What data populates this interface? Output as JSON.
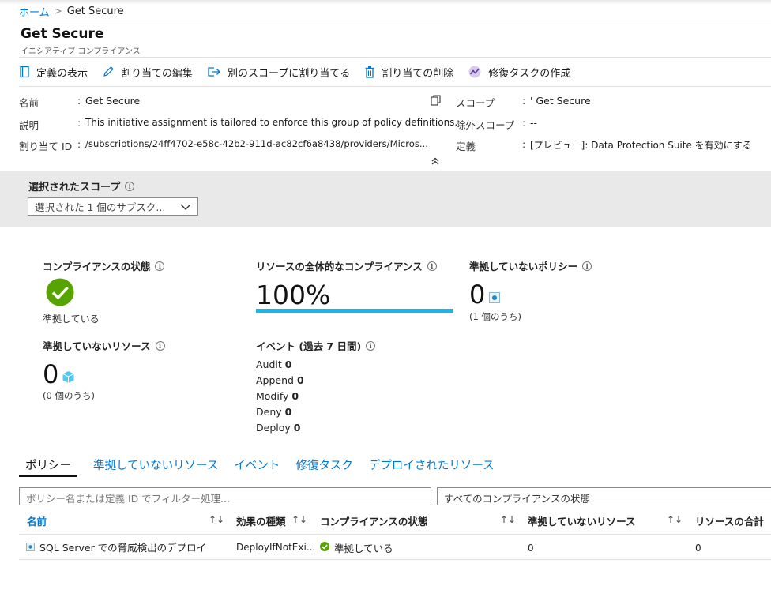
{
  "breadcrumb": {
    "home": "ホーム",
    "current": "Get Secure"
  },
  "header": {
    "title": "Get Secure",
    "subtitle": "イニシアティブ コンプライアンス"
  },
  "toolbar": {
    "view_definition": "定義の表示",
    "edit_assignment": "割り当ての編集",
    "assign_other_scope": "別のスコープに割り当てる",
    "delete_assignment": "割り当ての削除",
    "create_remediation": "修復タスクの作成"
  },
  "essentials": {
    "name_label": "名前",
    "name_value": "Get Secure",
    "desc_label": "説明",
    "desc_value": "This initiative assignment is tailored to enforce this group of policy definitions.",
    "id_label": "割り当て ID",
    "id_value": "/subscriptions/24ff4702-e58c-42b2-911d-ac82cf6a8438/providers/Micros...",
    "scope_label": "スコープ",
    "scope_value": "' Get Secure",
    "excluded_label": "除外スコープ",
    "excluded_value": "--",
    "definition_label": "定義",
    "definition_value": "[プレビュー]: Data Protection Suite を有効にする",
    "colon": ":"
  },
  "scope": {
    "title": "選択されたスコープ",
    "dropdown": "選択された 1 個のサブスク..."
  },
  "metrics": {
    "compliance_state_title": "コンプライアンスの状態",
    "compliance_state_value": "準拠している",
    "overall_title": "リソースの全体的なコンプライアンス",
    "overall_value": "100%",
    "overall_fraction": 1.0,
    "noncompliant_policies_title": "準拠していないポリシー",
    "noncompliant_policies_value": "0",
    "noncompliant_policies_sub": "(1 個のうち)",
    "noncompliant_resources_title": "準拠していないリソース",
    "noncompliant_resources_value": "0",
    "noncompliant_resources_sub": "(0 個のうち)",
    "events_title": "イベント (過去 7 日間)",
    "events": [
      {
        "label": "Audit",
        "count": "0"
      },
      {
        "label": "Append",
        "count": "0"
      },
      {
        "label": "Modify",
        "count": "0"
      },
      {
        "label": "Deny",
        "count": "0"
      },
      {
        "label": "Deploy",
        "count": "0"
      }
    ]
  },
  "tabs": [
    "ポリシー",
    "準拠していないリソース",
    "イベント",
    "修復タスク",
    "デプロイされたリソース"
  ],
  "filter": {
    "placeholder": "ポリシー名または定義 ID でフィルター処理...",
    "state_select": "すべてのコンプライアンスの状態"
  },
  "table": {
    "headers": [
      "名前",
      "効果の種類",
      "コンプライアンスの状態",
      "準拠していないリソース",
      "リソースの合計"
    ],
    "rows": [
      {
        "name": "SQL Server での脅威検出のデプロイ",
        "effect": "DeployIfNotExi...",
        "state": "準拠している",
        "noncompliant": "0",
        "total": "0"
      }
    ]
  },
  "colors": {
    "accent": "#0078d4",
    "success": "#57a300",
    "progress": "#1eb4e6"
  }
}
